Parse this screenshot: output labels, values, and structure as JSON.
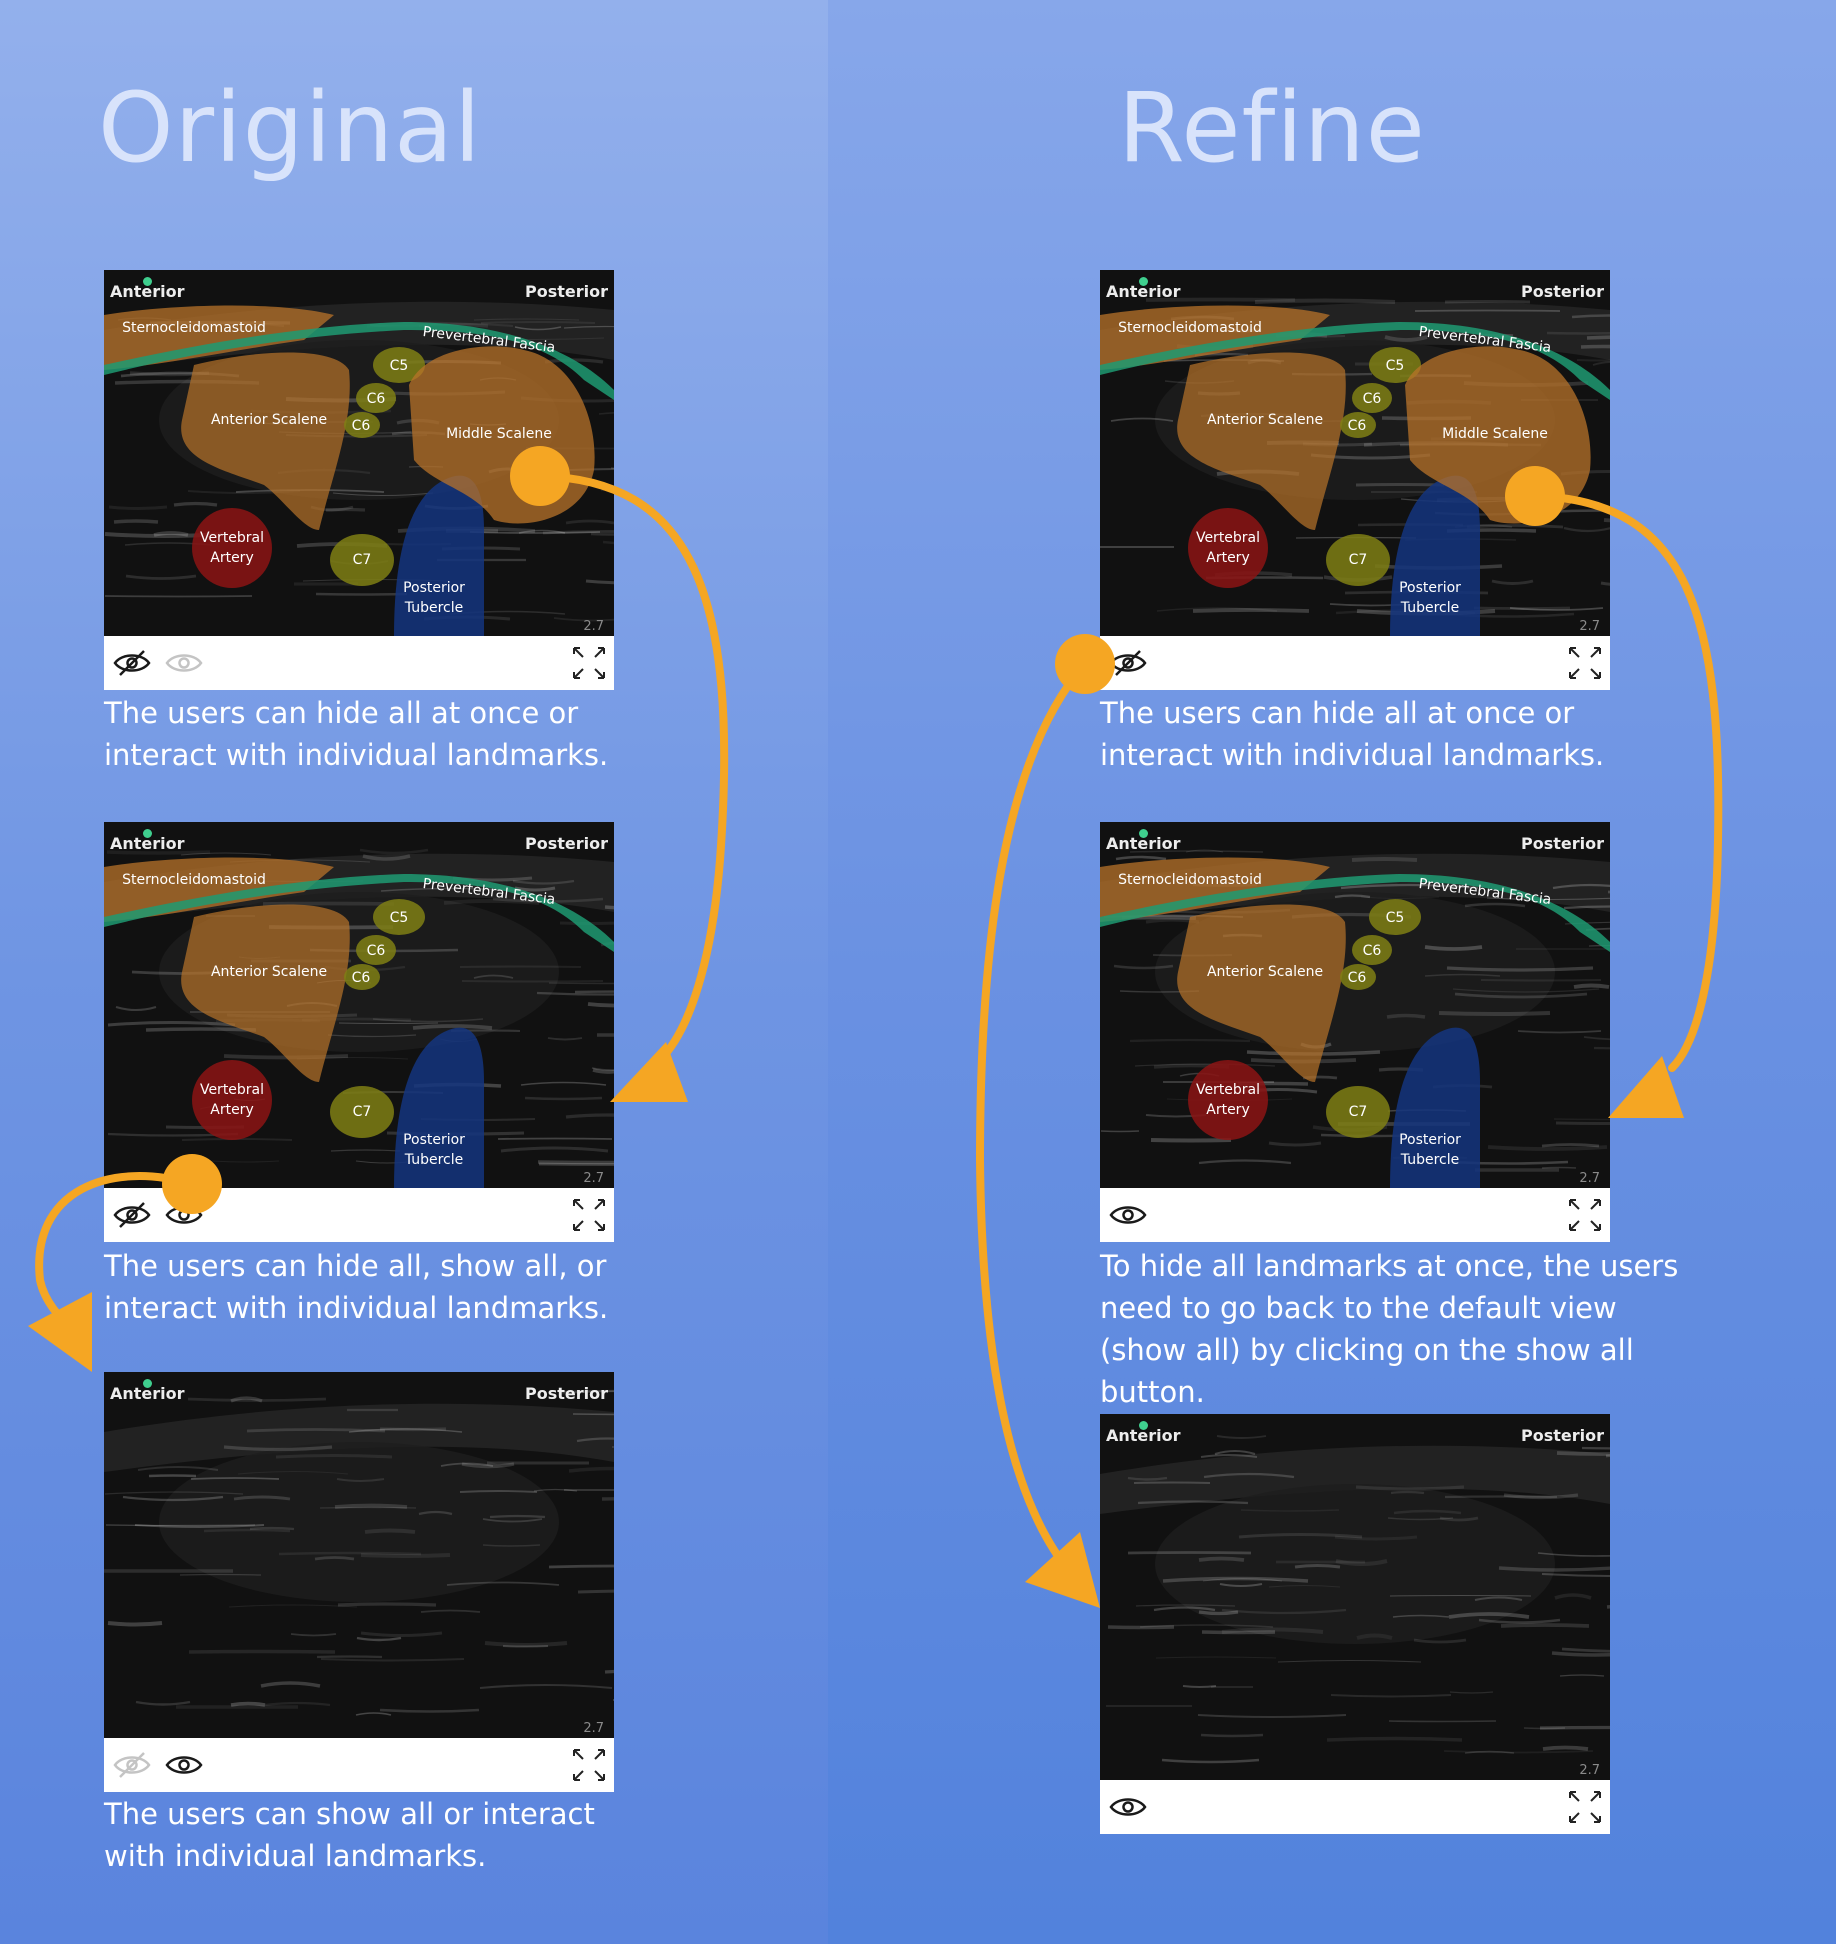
{
  "headings": {
    "original": "Original",
    "refine": "Refine"
  },
  "image": {
    "anterior": "Anterior",
    "posterior": "Posterior",
    "scale": "2.7"
  },
  "landmarks": {
    "scm": "Sternocleidomastoid",
    "fascia": "Prevertebral Fascia",
    "anterior_scalene": "Anterior Scalene",
    "middle_scalene": "Middle Scalene",
    "c5": "C5",
    "c6a": "C6",
    "c6b": "C6",
    "c7": "C7",
    "vertebral_artery_1": "Vertebral",
    "vertebral_artery_2": "Artery",
    "posterior_tubercle_1": "Posterior",
    "posterior_tubercle_2": "Tubercle"
  },
  "captions": {
    "original_1": "The users can hide all at once or interact with individual landmarks.",
    "original_2": "The users can hide all, show all, or interact with individual landmarks.",
    "original_3": "The users can show all or interact with individual landmarks.",
    "refine_1": "The users can hide all at once or interact with individual landmarks.",
    "refine_2": "To hide all landmarks at once, the users need to go back to the default view (show all) by clicking on the show all button."
  },
  "icons": {
    "hide": "eye-slash-icon",
    "show": "eye-icon",
    "expand": "expand-arrows-icon"
  },
  "colors": {
    "arrow": "#f5a623",
    "muscle": "#b8732a",
    "fascia": "#1f9a72",
    "nerve": "#7f7f14",
    "artery": "#8c1414",
    "tubercle": "#14357f"
  }
}
